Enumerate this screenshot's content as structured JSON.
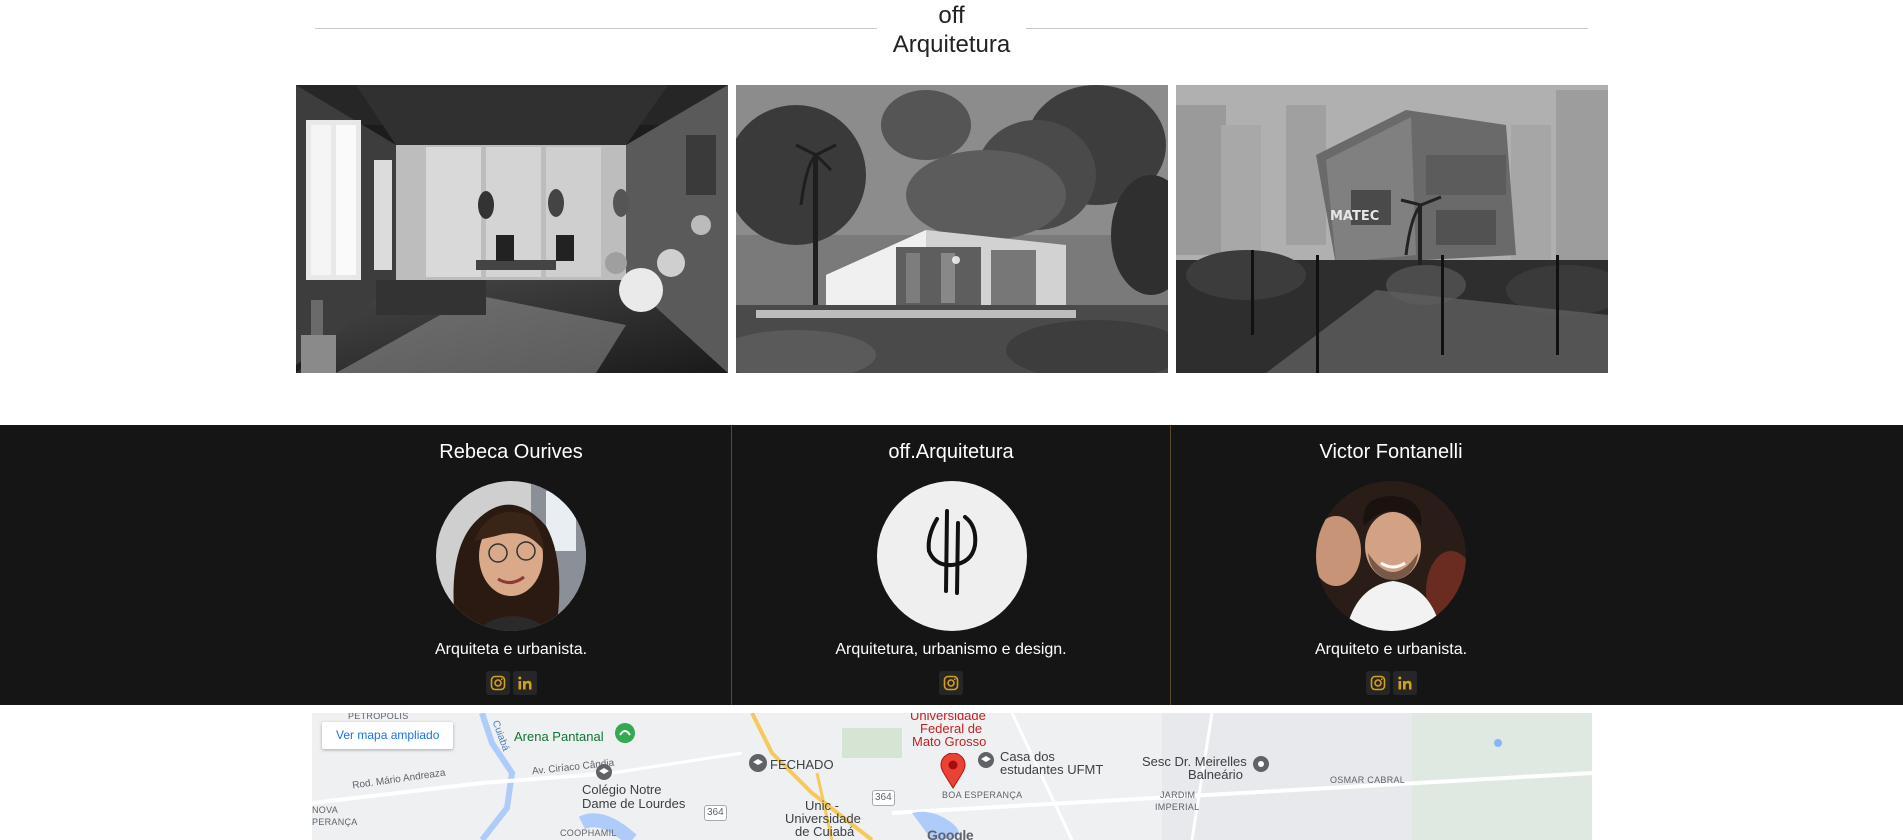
{
  "header": {
    "title_line1": "off",
    "title_line2": "Arquitetura"
  },
  "gallery": {
    "images": [
      {
        "name": "interior music studio render"
      },
      {
        "name": "house among trees render"
      },
      {
        "name": "MATEC building render",
        "sign": "MATEC"
      }
    ]
  },
  "team": {
    "members": [
      {
        "name": "Rebeca Ourives",
        "role": "Arquiteta e urbanista.",
        "socials": [
          "instagram-icon",
          "linkedin-icon"
        ]
      },
      {
        "name": "off.Arquitetura",
        "role": "Arquitetura, urbanismo e design.",
        "socials": [
          "instagram-icon"
        ]
      },
      {
        "name": "Victor Fontanelli",
        "role": "Arquiteto e urbanista.",
        "socials": [
          "instagram-icon",
          "linkedin-icon"
        ]
      }
    ],
    "accent": "#d4a017",
    "background": "#151515"
  },
  "map": {
    "expand_label": "Ver mapa ampliado",
    "places": {
      "arena": "Arena Pantanal",
      "colegio_1": "Colégio Notre",
      "colegio_2": "Dame de Lourdes",
      "fechado": "FECHADO",
      "unic_1": "Unic -",
      "unic_2": "Universidade",
      "unic_3": "de Cuiabá",
      "ufmt_1": "Universidade",
      "ufmt_2": "Federal de",
      "ufmt_3": "Mato Grosso",
      "casa_1": "Casa dos",
      "casa_2": "estudantes UFMT",
      "sesc_1": "Sesc Dr. Meirelles",
      "sesc_2": "Balneário",
      "boa_esperanca": "BOA ESPERANÇA",
      "jardim_1": "JARDIM",
      "jardim_2": "IMPERIAL",
      "osmar": "OSMAR CABRAL",
      "nova_1": "NOVA",
      "nova_2": "PERANÇA",
      "coophamil": "COOPHAMIL",
      "petropolis": "PETRÓPOLIS",
      "rod": "Rod. Mário Andreaza",
      "av_ciriaco": "Av. Ciríaco Cândia",
      "cuiaba_river": "Cuiabá",
      "road_364a": "364",
      "road_364b": "364",
      "google": "Google"
    }
  }
}
